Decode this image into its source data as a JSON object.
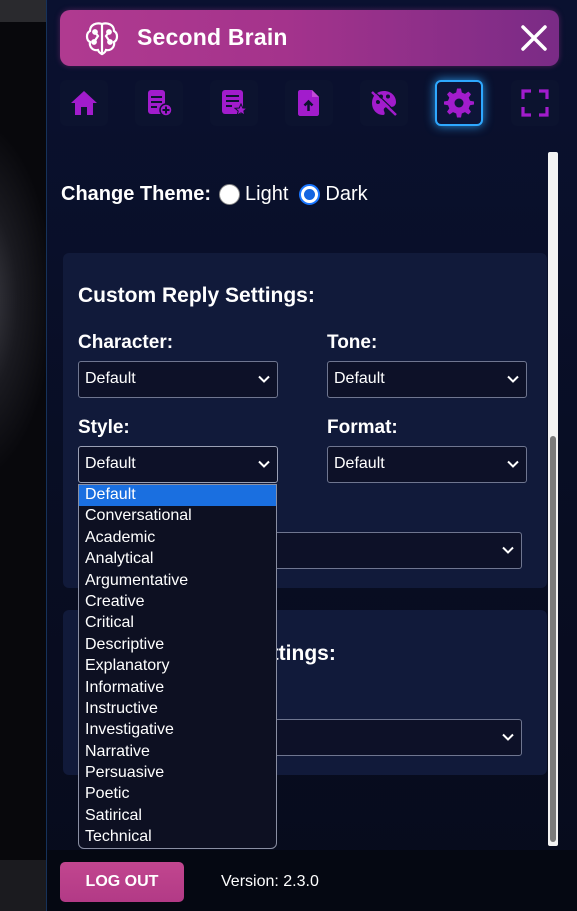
{
  "app": {
    "title": "Second Brain",
    "logo_icon": "brain-icon",
    "close_icon": "close-icon"
  },
  "colors": {
    "header_start": "#b03a90",
    "header_end": "#7a2b86",
    "icon_purple": "#a21ccc",
    "active_glow": "#2ea8ff",
    "selected_option": "#1a6fe0"
  },
  "toolbar": {
    "items": [
      {
        "icon": "home-icon"
      },
      {
        "icon": "add-note-icon"
      },
      {
        "icon": "saved-notes-icon"
      },
      {
        "icon": "upload-file-icon"
      },
      {
        "icon": "palette-icon"
      },
      {
        "icon": "settings-gear-icon",
        "active": true
      },
      {
        "icon": "fullscreen-icon"
      }
    ]
  },
  "theme": {
    "label": "Change Theme:",
    "options": [
      "Light",
      "Dark"
    ],
    "selected": "Dark"
  },
  "reply_settings": {
    "title": "Custom Reply Settings:",
    "character": {
      "label": "Character:",
      "value": "Default"
    },
    "tone": {
      "label": "Tone:",
      "value": "Default"
    },
    "style": {
      "label": "Style:",
      "value": "Default"
    },
    "format": {
      "label": "Format:",
      "value": "Default"
    }
  },
  "style_dropdown": {
    "options": [
      "Default",
      "Conversational",
      "Academic",
      "Analytical",
      "Argumentative",
      "Creative",
      "Critical",
      "Descriptive",
      "Explanatory",
      "Informative",
      "Instructive",
      "Investigative",
      "Narrative",
      "Persuasive",
      "Poetic",
      "Satirical",
      "Technical"
    ],
    "selected": "Default"
  },
  "second_card": {
    "title_fragment": "ettings:"
  },
  "footer": {
    "logout": "LOG OUT",
    "version": "Version: 2.3.0"
  }
}
